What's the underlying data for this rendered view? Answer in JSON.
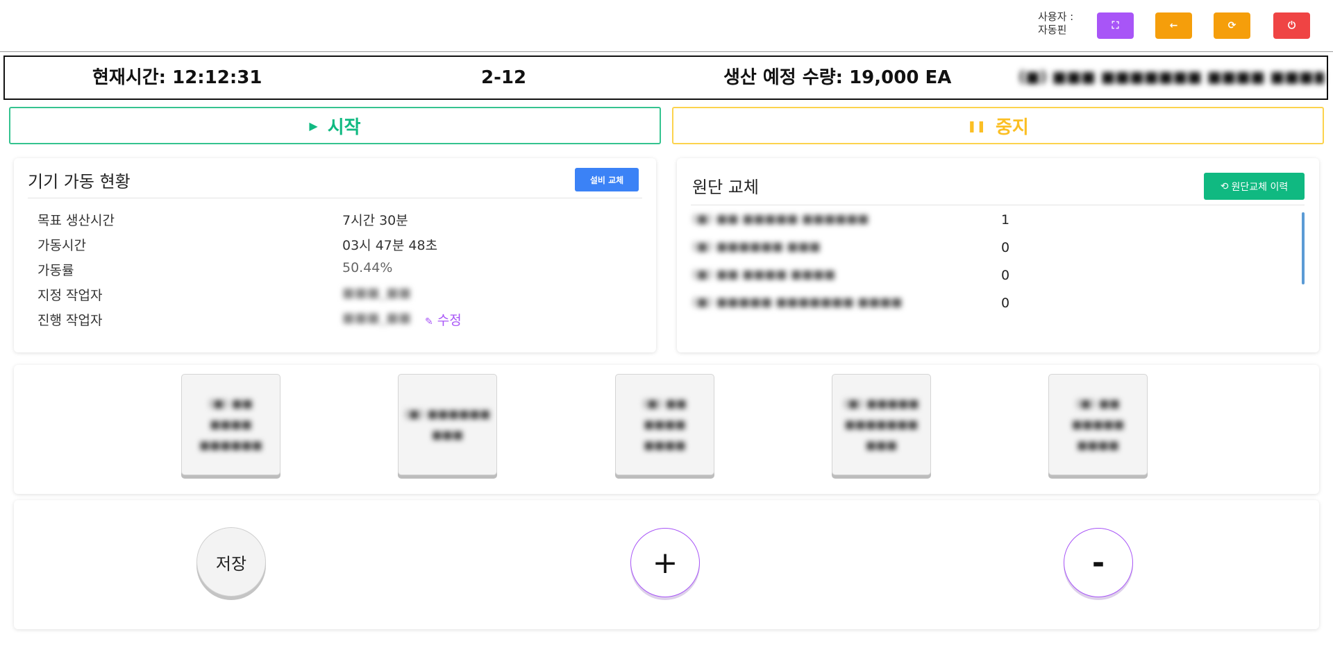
{
  "topbar": {
    "user_label": "사용자 :",
    "user_name": "자동핀",
    "buttons": [
      {
        "name": "fullscreen-button",
        "icon": "fullscreen-icon",
        "glyph": "⛶",
        "color": "#a855f7"
      },
      {
        "name": "back-button",
        "icon": "arrow-left-icon",
        "glyph": "←",
        "color": "#f59e0b"
      },
      {
        "name": "refresh-button",
        "icon": "refresh-icon",
        "glyph": "⟳",
        "color": "#f59e0b"
      },
      {
        "name": "power-button",
        "icon": "power-icon",
        "glyph": "⏻",
        "color": "#ef4444"
      }
    ]
  },
  "infobar": {
    "current_time": "현재시간: 12:12:31",
    "lot": "2-12",
    "planned_qty": "생산 예정 수량: 19,000 EA",
    "product": "(■) ■■■ ■■■■■■■ ■■■■ ■■■■"
  },
  "controls": {
    "start_label": "시작",
    "stop_label": "중지",
    "start_color": "#10b981",
    "stop_color": "#fbbf24"
  },
  "status_card": {
    "title": "기기 가동 현황",
    "replace_button": "설비 교체",
    "rows": [
      {
        "label": "목표 생산시간",
        "value": "7시간 30분"
      },
      {
        "label": "가동시간",
        "value": "03시 47분 48초"
      },
      {
        "label": "가동률",
        "value": "50.44%"
      },
      {
        "label": "지정 작업자",
        "value": "■■■_■■"
      },
      {
        "label": "진행 작업자",
        "value": "■■■_■■"
      }
    ],
    "edit_label": "수정"
  },
  "material_card": {
    "title": "원단 교체",
    "history_button": "원단교체 이력",
    "items": [
      {
        "name": "(■) ■■ ■■■■■ ■■■■■■",
        "count": "1"
      },
      {
        "name": "(■) ■■■■■■ ■■■",
        "count": "0"
      },
      {
        "name": "(■) ■■ ■■■■ ■■■■",
        "count": "0"
      },
      {
        "name": "(■) ■■■■■ ■■■■■■■ ■■■■",
        "count": "0"
      }
    ]
  },
  "tiles": [
    "(■) ■■ ■■■■ ■■■■■■",
    "(■) ■■■■■■ ■■■",
    "(■) ■■ ■■■■ ■■■■",
    "(■) ■■■■■ ■■■■■■■ ■■■",
    "(■) ■■ ■■■■■ ■■■■"
  ],
  "actions": {
    "save_label": "저장",
    "plus_label": "+",
    "minus_label": "-"
  }
}
